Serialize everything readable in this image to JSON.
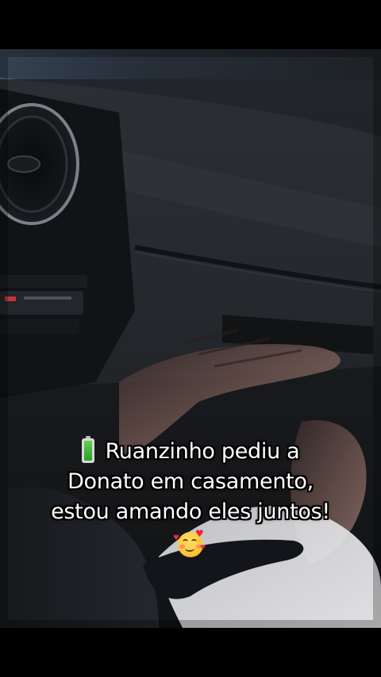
{
  "caption": {
    "line1": "Ruanzinho pediu a",
    "line2": "Donato em casamento,",
    "line3": "estou amando eles juntos!",
    "leading_icon": "battery-full-icon",
    "trailing_icon": "smiling-face-with-hearts-icon",
    "text_color": "#ffffff",
    "outline_color": "#000000"
  },
  "scene": {
    "subject": "car-interior-dashboard-and-hands",
    "palette": {
      "dashboard": "#2a2d31",
      "shadow": "#0d0e10",
      "sleeve": "#e9e9ec",
      "skin": "#a57c74",
      "ambient_blue": "#4a6a93"
    }
  }
}
